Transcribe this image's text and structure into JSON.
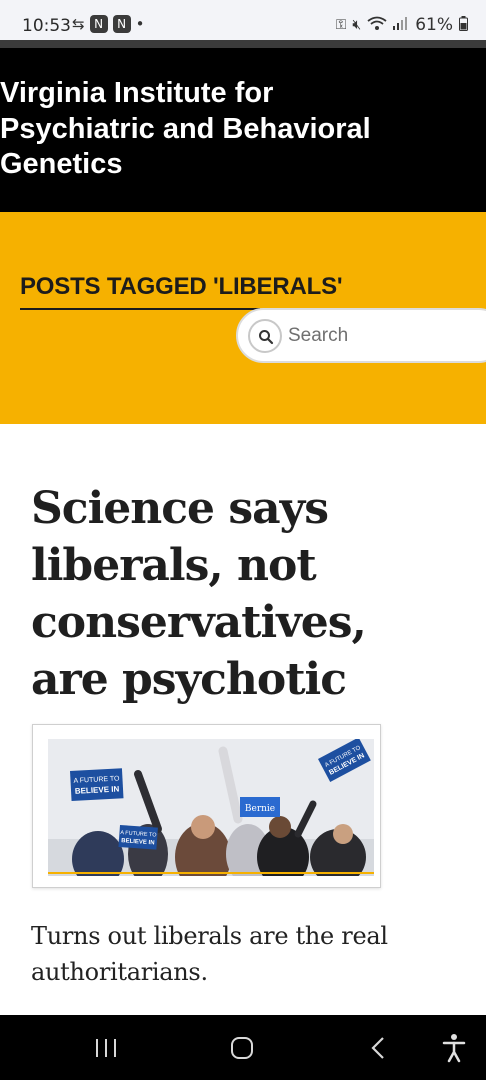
{
  "status_bar": {
    "time": "10:53",
    "left_icons": [
      "cast-icon",
      "app-icon",
      "app-icon"
    ],
    "dot": "•",
    "battery": "61%"
  },
  "header": {
    "site_title": "Virginia Institute for Psychiatric and Behavioral Genetics"
  },
  "tag_section": {
    "heading": "POSTS TAGGED 'LIBERALS'",
    "search": {
      "placeholder": "Search",
      "value": ""
    }
  },
  "article": {
    "title": "Science says liberals, not conservatives, are psychotic",
    "excerpt": "Turns out liberals are the real authoritarians.",
    "image": {
      "sign_text_1": "A FUTURE TO",
      "sign_text_2": "BELIEVE IN",
      "sign_text_3": "Bernie"
    }
  },
  "nav_bar": {
    "buttons": [
      "recent-apps",
      "home",
      "back",
      "accessibility"
    ]
  },
  "colors": {
    "header_bg": "#000000",
    "band_bg": "#f6b100",
    "text_dark": "#1f1f1f"
  }
}
